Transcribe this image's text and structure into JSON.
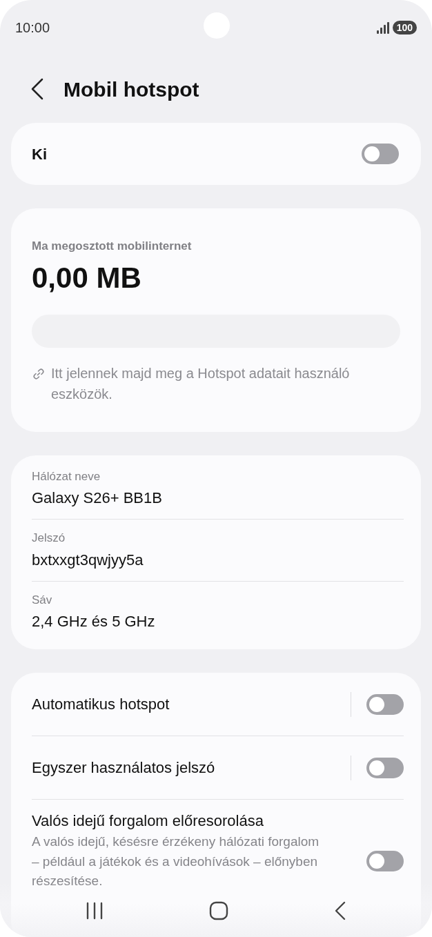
{
  "status_bar": {
    "time": "10:00",
    "battery": "100"
  },
  "header": {
    "title": "Mobil hotspot"
  },
  "master_switch": {
    "label": "Ki",
    "on": false
  },
  "usage": {
    "label": "Ma megosztott mobilinternet",
    "amount": "0,00 MB",
    "level": 0,
    "hint": "Itt jelennek majd meg a Hotspot adatait használó eszközök."
  },
  "network": [
    {
      "label": "Hálózat neve",
      "value": "Galaxy S26+ BB1B"
    },
    {
      "label": "Jelszó",
      "value": "bxtxxgt3qwjyy5a"
    },
    {
      "label": "Sáv",
      "value": "2,4 GHz és 5 GHz"
    }
  ],
  "settings": [
    {
      "kind": "split",
      "title": "Automatikus hotspot",
      "on": false
    },
    {
      "kind": "split",
      "title": "Egyszer használatos jelszó",
      "on": false
    },
    {
      "kind": "described",
      "title": "Valós idejű forgalom előresorolása",
      "description": "A valós idejű, késésre érzékeny hálózati forgalom – például a játékok és a videohívások – előnyben részesítése.",
      "on": false
    }
  ]
}
